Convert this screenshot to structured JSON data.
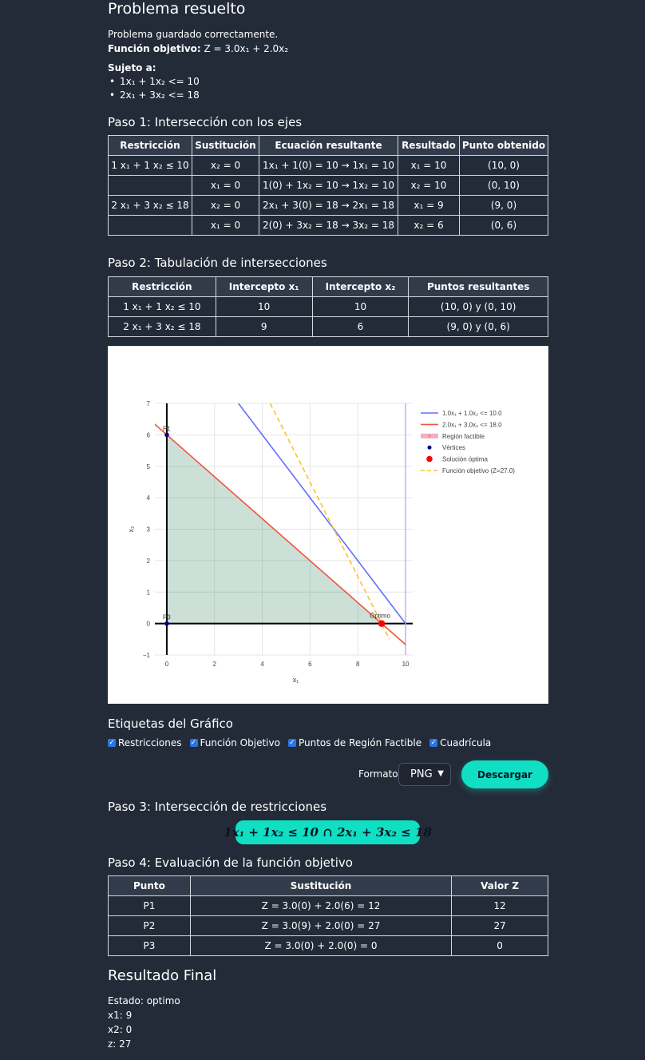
{
  "header": {
    "title": "Problema resuelto",
    "saved_message": "Problema guardado correctamente.",
    "objective_label": "Función objetivo:",
    "objective_value": "Z = 3.0x₁ + 2.0x₂",
    "subject_label": "Sujeto a:",
    "constraints": [
      "1x₁ + 1x₂ <= 10",
      "2x₁ + 3x₂ <= 18"
    ]
  },
  "step1": {
    "title": "Paso 1: Intersección con los ejes",
    "columns": [
      "Restricción",
      "Sustitución",
      "Ecuación resultante",
      "Resultado",
      "Punto obtenido"
    ],
    "rows": [
      [
        "1 x₁ + 1 x₂ ≤ 10",
        "x₂ = 0",
        "1x₁ + 1(0) = 10 → 1x₁ = 10",
        "x₁ = 10",
        "(10, 0)"
      ],
      [
        "",
        "x₁ = 0",
        "1(0) + 1x₂ = 10 → 1x₂ = 10",
        "x₂ = 10",
        "(0, 10)"
      ],
      [
        "2 x₁ + 3 x₂ ≤ 18",
        "x₂ = 0",
        "2x₁ + 3(0) = 18 → 2x₁ = 18",
        "x₁ = 9",
        "(9, 0)"
      ],
      [
        "",
        "x₁ = 0",
        "2(0) + 3x₂ = 18 → 3x₂ = 18",
        "x₂ = 6",
        "(0, 6)"
      ]
    ]
  },
  "step2": {
    "title": "Paso 2: Tabulación de intersecciones",
    "columns": [
      "Restricción",
      "Intercepto x₁",
      "Intercepto x₂",
      "Puntos resultantes"
    ],
    "rows": [
      [
        "1 x₁ + 1 x₂ ≤ 10",
        "10",
        "10",
        "(10, 0) y (0, 10)"
      ],
      [
        "2 x₁ + 3 x₂ ≤ 18",
        "9",
        "6",
        "(9, 0) y (0, 6)"
      ]
    ]
  },
  "chart_data": {
    "type": "line",
    "xlabel": "x₁",
    "ylabel": "x₂",
    "xlim": [
      -0.5,
      10.3
    ],
    "ylim": [
      -1,
      7
    ],
    "x_ticks": [
      "0",
      "2",
      "4",
      "6",
      "8",
      "10"
    ],
    "y_ticks": [
      "−1",
      "0",
      "1",
      "2",
      "3",
      "4",
      "5",
      "6",
      "7"
    ],
    "grid": true,
    "legend_position": "top-right",
    "series": [
      {
        "name": "1.0x₁ + 1.0x₂ <= 10.0",
        "color": "#636efa",
        "x": [
          3,
          10
        ],
        "y": [
          7,
          0
        ]
      },
      {
        "name": "2.0x₁ + 3.0x₂ <= 18.0",
        "color": "#ef553b",
        "x": [
          -1,
          10
        ],
        "y": [
          6.667,
          -0.667
        ]
      },
      {
        "name": "Región factible",
        "color": "#2e7d5b",
        "points": [
          [
            0,
            0
          ],
          [
            0,
            6
          ],
          [
            9,
            0
          ]
        ]
      },
      {
        "name": "Vértices",
        "color": "#00008b",
        "points": [
          [
            0,
            6
          ],
          [
            9,
            0
          ],
          [
            0,
            0
          ]
        ],
        "labels": [
          "P1",
          "P2",
          "P3"
        ]
      },
      {
        "name": "Solución óptima",
        "color": "#ff0000",
        "points": [
          [
            9,
            0
          ]
        ],
        "label": "Óptimo"
      },
      {
        "name": "Función objetivo (Z=27.0)",
        "color": "#fec228",
        "x": [
          4.33,
          9.33
        ],
        "y": [
          7,
          -0.5
        ]
      }
    ],
    "axis_lines": {
      "x1_zero": true,
      "x2_zero": true,
      "x1_ten": true
    }
  },
  "labels_panel": {
    "title": "Etiquetas del Gráfico",
    "options": [
      {
        "label": "Restricciones",
        "checked": true
      },
      {
        "label": "Función Objetivo",
        "checked": true
      },
      {
        "label": "Puntos de Región Factible",
        "checked": true
      },
      {
        "label": "Cuadrícula",
        "checked": true
      }
    ],
    "format_label": "Formato",
    "format_value": "PNG",
    "download_label": "Descargar"
  },
  "step3": {
    "title": "Paso 3: Intersección de restricciones",
    "formula": "1x₁ + 1x₂ ≤ 10 ∩ 2x₁ + 3x₂ ≤ 18"
  },
  "step4": {
    "title": "Paso 4: Evaluación de la función objetivo",
    "columns": [
      "Punto",
      "Sustitución",
      "Valor Z"
    ],
    "rows": [
      [
        "P1",
        "Z = 3.0(0) + 2.0(6) = 12",
        "12"
      ],
      [
        "P2",
        "Z = 3.0(9) + 2.0(0) = 27",
        "27"
      ],
      [
        "P3",
        "Z = 3.0(0) + 2.0(0) = 0",
        "0"
      ]
    ]
  },
  "result": {
    "title": "Resultado Final",
    "lines": [
      "Estado: optimo",
      "x1: 9",
      "x2: 0",
      "z: 27"
    ]
  }
}
